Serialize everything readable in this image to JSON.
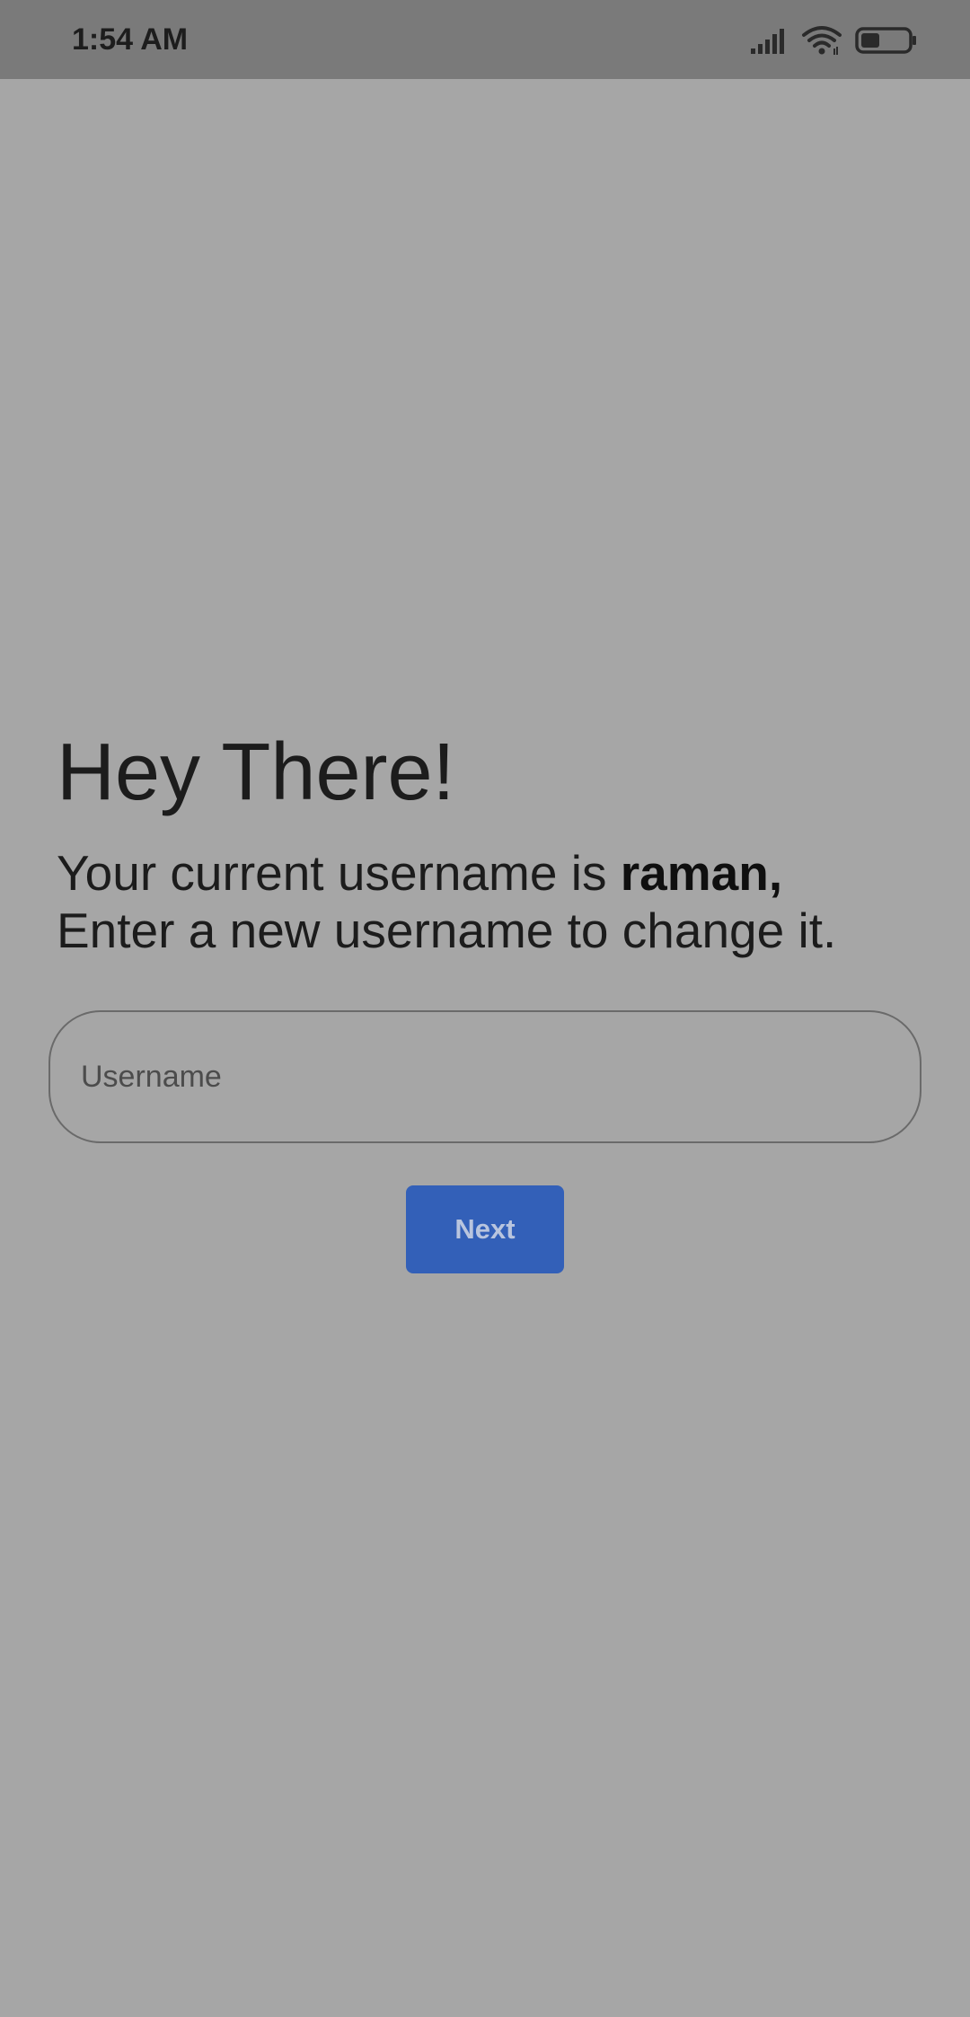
{
  "status_bar": {
    "time": "1:54 AM",
    "icons": [
      "signal-icon",
      "wifi-icon",
      "battery-icon"
    ],
    "battery_level_percent": 40
  },
  "content": {
    "title": "Hey There!",
    "subtitle_prefix": "Your current username is ",
    "current_username": "raman,",
    "subtitle_line2": "Enter a new username to change it."
  },
  "form": {
    "username_placeholder": "Username",
    "username_value": "",
    "next_label": "Next"
  },
  "colors": {
    "background": "#a6a6a6",
    "status_bar": "#7a7a7a",
    "primary_button": "#3360b8"
  }
}
